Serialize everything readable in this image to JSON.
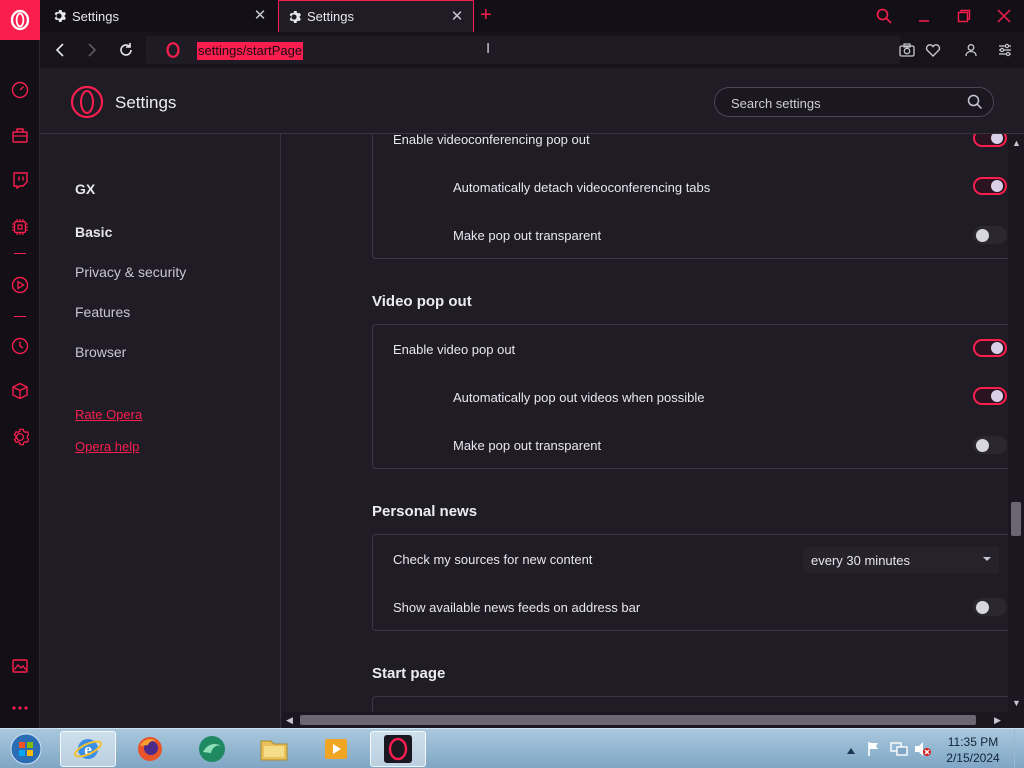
{
  "tabs": [
    {
      "label": "Settings",
      "icon": "gear-icon"
    },
    {
      "label": "Settings",
      "icon": "gear-icon",
      "active": true
    }
  ],
  "address": {
    "url": "settings/startPage"
  },
  "header": {
    "title": "Settings",
    "search_placeholder": "Search settings"
  },
  "nav": {
    "items": [
      "GX",
      "Basic",
      "Privacy & security",
      "Features",
      "Browser"
    ],
    "links": [
      "Rate Opera",
      "Opera help"
    ]
  },
  "videoconf": {
    "enable_label": "Enable videoconferencing pop out",
    "enable_on": true,
    "detach_label": "Automatically detach videoconferencing tabs",
    "detach_on": true,
    "transparent_label": "Make pop out transparent",
    "transparent_on": false
  },
  "video_popout": {
    "title": "Video pop out",
    "enable_label": "Enable video pop out",
    "enable_on": true,
    "auto_label": "Automatically pop out videos when possible",
    "auto_on": true,
    "transparent_label": "Make pop out transparent",
    "transparent_on": false
  },
  "news": {
    "title": "Personal news",
    "check_label": "Check my sources for new content",
    "check_value": "every 30 minutes",
    "feeds_label": "Show available news feeds on address bar",
    "feeds_on": false
  },
  "start_page": {
    "title": "Start page"
  },
  "taskbar": {
    "time": "11:35 PM",
    "date": "2/15/2024"
  },
  "colors": {
    "accent": "#fa1e4e",
    "background": "#1f1c26"
  }
}
